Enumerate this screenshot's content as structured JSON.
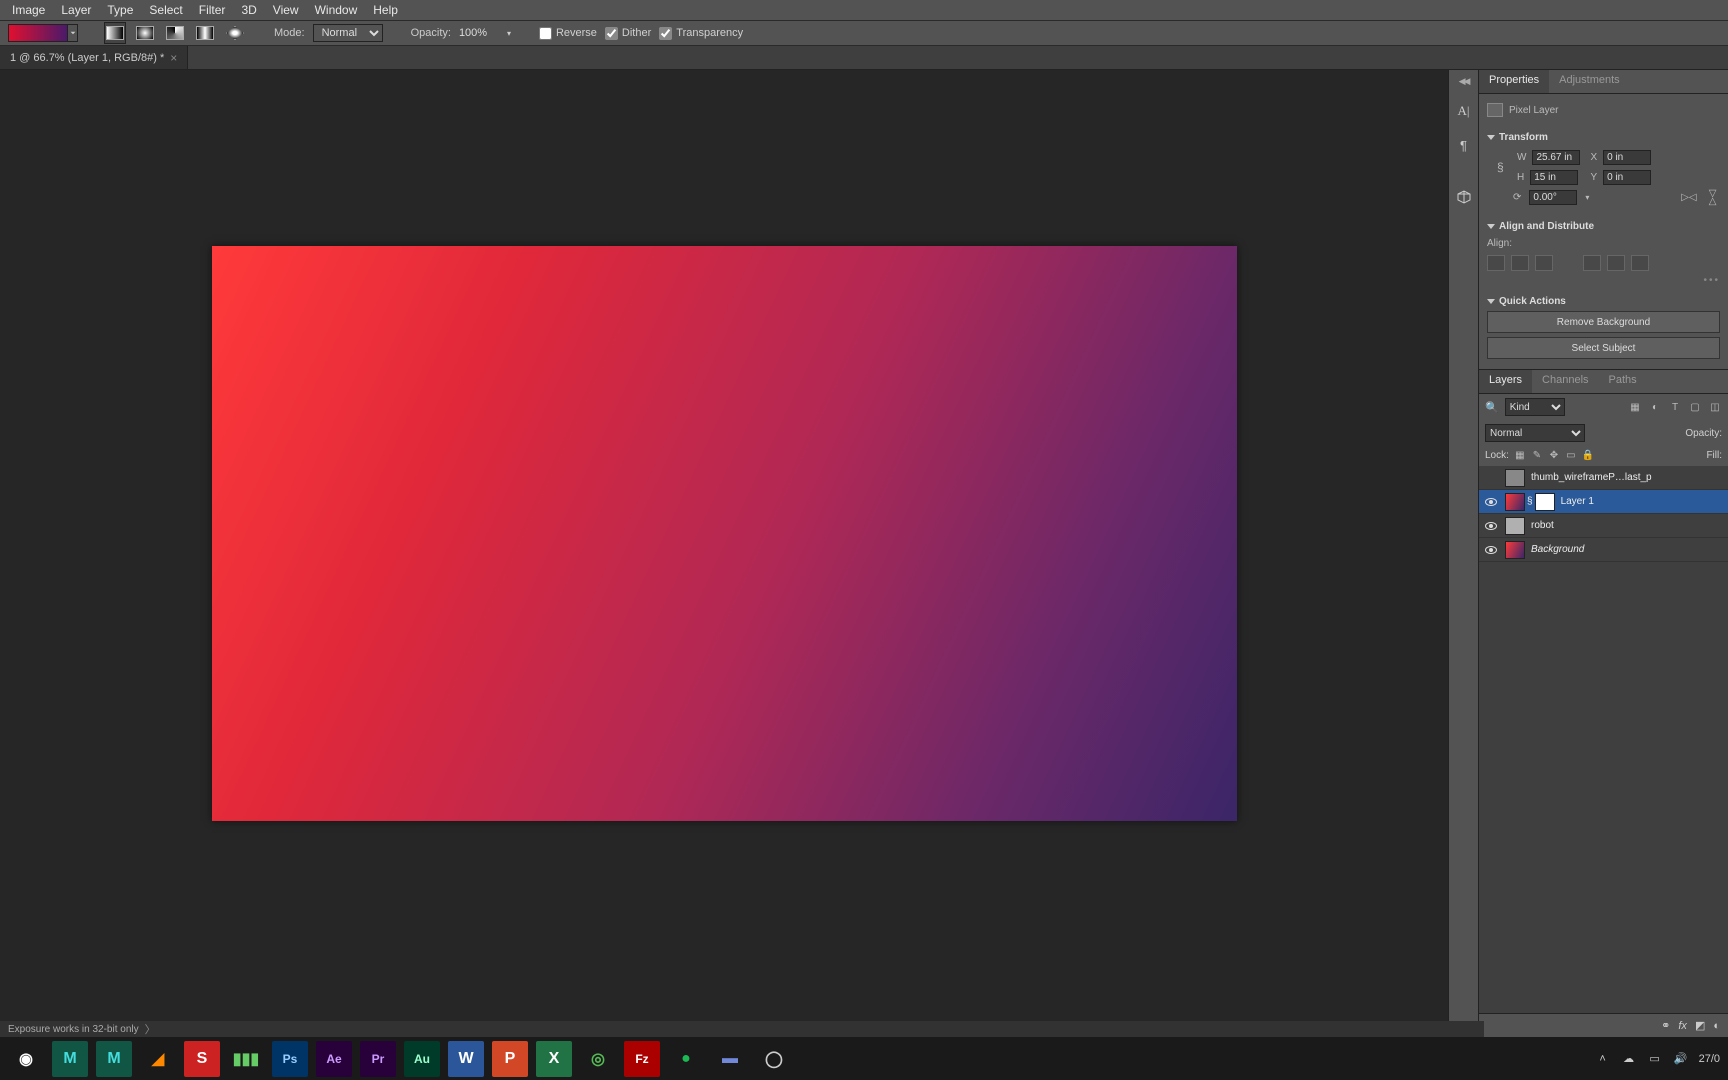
{
  "menu": {
    "items": [
      "Image",
      "Layer",
      "Type",
      "Select",
      "Filter",
      "3D",
      "View",
      "Window",
      "Help"
    ]
  },
  "options": {
    "mode_label": "Mode:",
    "mode_value": "Normal",
    "opacity_label": "Opacity:",
    "opacity_value": "100%",
    "reverse_label": "Reverse",
    "reverse_checked": false,
    "dither_label": "Dither",
    "dither_checked": true,
    "transparency_label": "Transparency",
    "transparency_checked": true
  },
  "document": {
    "tab_title": "1 @ 66.7% (Layer 1, RGB/8#) *"
  },
  "properties": {
    "tabs": {
      "properties": "Properties",
      "adjustments": "Adjustments"
    },
    "layer_type": "Pixel Layer",
    "sections": {
      "transform": "Transform",
      "align": "Align and Distribute",
      "align_label": "Align:",
      "quick_actions": "Quick Actions"
    },
    "transform": {
      "W_label": "W",
      "W_value": "25.67 in",
      "H_label": "H",
      "H_value": "15 in",
      "X_label": "X",
      "X_value": "0 in",
      "Y_label": "Y",
      "Y_value": "0 in",
      "angle_value": "0.00°"
    },
    "quick_actions": {
      "remove_bg": "Remove Background",
      "select_subject": "Select Subject"
    }
  },
  "layers": {
    "tabs": {
      "layers": "Layers",
      "channels": "Channels",
      "paths": "Paths"
    },
    "filter_label": "Kind",
    "blend_mode": "Normal",
    "opacity_label": "Opacity:",
    "lock_label": "Lock:",
    "fill_label": "Fill:",
    "items": [
      {
        "name": "thumb_wireframeP…last_p",
        "visible": false,
        "selected": false,
        "italic": false,
        "thumb": "#888"
      },
      {
        "name": "Layer 1",
        "visible": true,
        "selected": true,
        "italic": false,
        "thumb": "linear-gradient(115deg,#ff3a3a,#3a2668)",
        "mask": true
      },
      {
        "name": "robot",
        "visible": true,
        "selected": false,
        "italic": false,
        "thumb": "#b0b0b0"
      },
      {
        "name": "Background",
        "visible": true,
        "selected": false,
        "italic": true,
        "thumb": "linear-gradient(115deg,#ff3a3a,#3a2668)"
      }
    ]
  },
  "status": {
    "text": "Exposure works in 32-bit only"
  },
  "taskbar": {
    "apps": [
      {
        "name": "chrome",
        "color": "#fff",
        "bg": "transparent",
        "glyph": "◉"
      },
      {
        "name": "maya1",
        "color": "#4dd",
        "bg": "#154",
        "glyph": "M"
      },
      {
        "name": "maya2",
        "color": "#4dd",
        "bg": "#154",
        "glyph": "M"
      },
      {
        "name": "blender",
        "color": "#f80",
        "bg": "transparent",
        "glyph": "◢"
      },
      {
        "name": "sketchup",
        "color": "#fff",
        "bg": "#c22",
        "glyph": "S"
      },
      {
        "name": "stats",
        "color": "#6c6",
        "bg": "transparent",
        "glyph": "▮▮▮"
      },
      {
        "name": "photoshop",
        "color": "#9cf",
        "bg": "#003366",
        "glyph": "Ps"
      },
      {
        "name": "aftereffects",
        "color": "#c9f",
        "bg": "#28003a",
        "glyph": "Ae"
      },
      {
        "name": "premiere",
        "color": "#c9f",
        "bg": "#28003a",
        "glyph": "Pr"
      },
      {
        "name": "audition",
        "color": "#9fc",
        "bg": "#003a28",
        "glyph": "Au"
      },
      {
        "name": "word",
        "color": "#fff",
        "bg": "#2b579a",
        "glyph": "W"
      },
      {
        "name": "powerpoint",
        "color": "#fff",
        "bg": "#d24726",
        "glyph": "P"
      },
      {
        "name": "excel",
        "color": "#fff",
        "bg": "#217346",
        "glyph": "X"
      },
      {
        "name": "circle1",
        "color": "#5b5",
        "bg": "transparent",
        "glyph": "◎"
      },
      {
        "name": "filezilla",
        "color": "#fff",
        "bg": "#a00",
        "glyph": "Fz"
      },
      {
        "name": "spotify",
        "color": "#1db954",
        "bg": "transparent",
        "glyph": "●"
      },
      {
        "name": "discord",
        "color": "#7289da",
        "bg": "transparent",
        "glyph": "▬"
      },
      {
        "name": "obs",
        "color": "#ccc",
        "bg": "transparent",
        "glyph": "◯"
      }
    ],
    "tray": {
      "date": "27/0",
      "caret": "˄",
      "cloud": "☁",
      "monitor": "▭",
      "volume": "🔊"
    }
  },
  "colors": {
    "gradient_start": "#ff3a3a",
    "gradient_end": "#3a2668"
  }
}
